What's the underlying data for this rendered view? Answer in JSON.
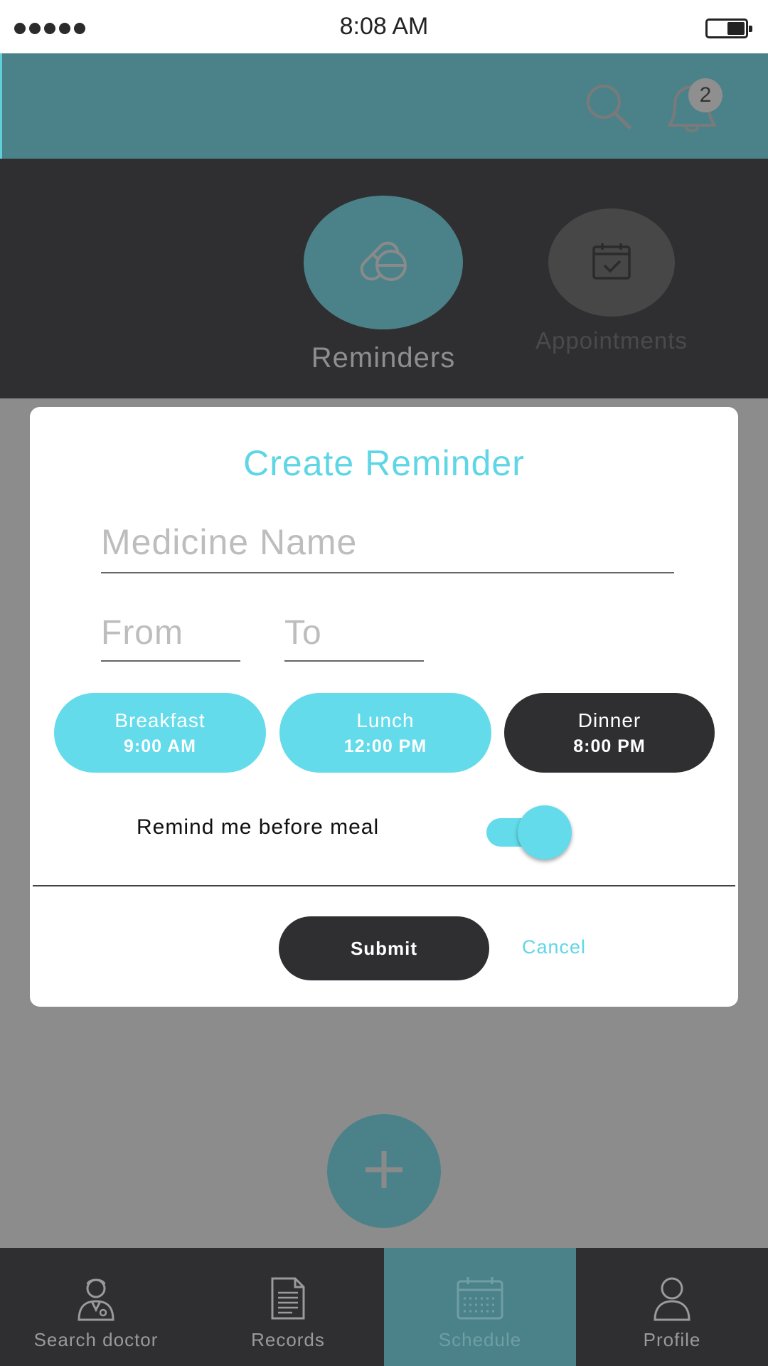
{
  "status_bar": {
    "time": "8:08 AM",
    "signal_icon": "signal-dots-icon",
    "battery_icon": "battery-icon"
  },
  "header": {
    "search_icon": "search-icon",
    "bell_icon": "bell-icon",
    "notification_count": "2",
    "colors": {
      "header_bg": "#4b8289",
      "accent": "#63dbea"
    }
  },
  "segments": {
    "reminders": {
      "label": "Reminders",
      "icon": "pill-icon",
      "active": true
    },
    "appointments": {
      "label": "Appointments",
      "icon": "calendar-check-icon",
      "active": false
    }
  },
  "modal": {
    "title": "Create Reminder",
    "medicine_placeholder": "Medicine Name",
    "from_placeholder": "From",
    "to_placeholder": "To",
    "meals": [
      {
        "name": "Breakfast",
        "time": "9:00 AM",
        "selected": true
      },
      {
        "name": "Lunch",
        "time": "12:00 PM",
        "selected": true
      },
      {
        "name": "Dinner",
        "time": "8:00 PM",
        "selected": false
      }
    ],
    "remind_label": "Remind me before meal",
    "remind_toggle_on": true,
    "submit_label": "Submit",
    "cancel_label": "Cancel"
  },
  "fab": {
    "icon": "plus-icon"
  },
  "bottom_nav": {
    "items": [
      {
        "label": "Search doctor",
        "icon": "doctor-icon",
        "active": false
      },
      {
        "label": "Records",
        "icon": "document-icon",
        "active": false
      },
      {
        "label": "Schedule",
        "icon": "calendar-icon",
        "active": true
      },
      {
        "label": "Profile",
        "icon": "user-icon",
        "active": false
      }
    ]
  }
}
